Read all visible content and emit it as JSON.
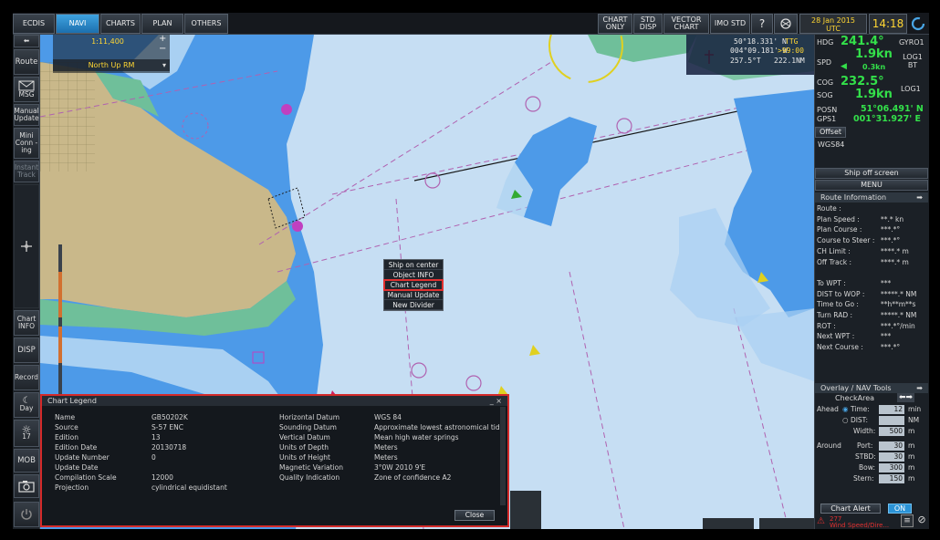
{
  "topbar": {
    "tabs": [
      "ECDIS",
      "NAVI",
      "CHARTS",
      "PLAN",
      "OTHERS"
    ],
    "chart_only": "CHART ONLY",
    "std_disp": "STD DISP",
    "vector_chart": "VECTOR CHART",
    "imo_std": "IMO STD",
    "date": "28 Jan 2015",
    "tz": "UTC",
    "time": "14:18"
  },
  "leftbar": {
    "route": "Route",
    "msg": "MSG",
    "manual_update": "Manual Update",
    "mini_conning": "Mini Conn -ing",
    "instant_track": "Instant Track",
    "chart_info": "Chart INFO",
    "disp": "DISP",
    "record": "Record",
    "day": "Day",
    "brightness": "17",
    "mob": "MOB"
  },
  "map": {
    "scale": "1:11,400",
    "orientation": "North Up RM",
    "cursor": {
      "lat": "50°18.331' N",
      "lon": "004°09.181' W",
      "brg": "257.5°T",
      "rng": "222.1NM",
      "ttg": "TTG",
      "ttg_val": ">99:00"
    }
  },
  "context_menu": {
    "items": [
      "Ship on center",
      "Object INFO",
      "Chart Legend",
      "Manual Update",
      "New Divider"
    ]
  },
  "legend": {
    "title": "Chart Legend",
    "left": [
      [
        "Name",
        "GB50202K"
      ],
      [
        "Source",
        "S-57 ENC"
      ],
      [
        "Edition",
        "13"
      ],
      [
        "Edition Date",
        "20130718"
      ],
      [
        "Update Number",
        "0"
      ],
      [
        "Update Date",
        ""
      ],
      [
        "Compilation Scale",
        "12000"
      ],
      [
        "Projection",
        "cylindrical equidistant"
      ]
    ],
    "right": [
      [
        "Horizontal Datum",
        "WGS 84"
      ],
      [
        "Sounding Datum",
        "Approximate lowest astronomical tide"
      ],
      [
        "Vertical Datum",
        "Mean high water springs"
      ],
      [
        "Units of Depth",
        "Meters"
      ],
      [
        "Units of Height",
        "Meters"
      ],
      [
        "Magnetic Variation",
        "3°0W 2010 9'E"
      ],
      [
        "Quality Indication",
        "Zone of confidence A2"
      ]
    ],
    "close": "Close"
  },
  "right": {
    "hdg_label": "HDG",
    "hdg": "241.4°",
    "hdg_src": "GYRO1",
    "spd_label": "SPD",
    "spd": "1.9kn",
    "spd_src": "LOG1 BT",
    "spd_sub": "0.3kn",
    "cog_label": "COG",
    "cog": "232.5°",
    "sog_label": "SOG",
    "sog": "1.9kn",
    "sog_src": "LOG1",
    "posn_label": "POSN",
    "gps_label": "GPS1",
    "lat": "51°06.491' N",
    "lon": "001°31.927' E",
    "offset": "Offset",
    "datum": "WGS84",
    "ship_off": "Ship off screen",
    "menu": "MENU",
    "route_info": "Route Information",
    "route_rows": [
      [
        "Route :",
        ""
      ],
      [
        "Plan Speed :",
        "**.* kn"
      ],
      [
        "Plan Course :",
        "***.*°"
      ],
      [
        "Course to Steer :",
        "***.*°"
      ],
      [
        "CH Limit :",
        "****.* m"
      ],
      [
        "Off Track :",
        "****.* m"
      ],
      [
        "",
        ""
      ],
      [
        "To WPT :",
        "***"
      ],
      [
        "DIST to WOP :",
        "*****.* NM"
      ],
      [
        "Time to Go :",
        "**h**m**s"
      ],
      [
        "Turn RAD :",
        "*****.* NM"
      ],
      [
        "ROT :",
        "***.*°/min"
      ],
      [
        "Next WPT :",
        "***"
      ],
      [
        "Next Course :",
        "***.*°"
      ]
    ],
    "overlay_tools": "Overlay / NAV Tools",
    "check_area": "CheckArea",
    "ahead": "Ahead",
    "time_lbl": "Time:",
    "time_val": "12",
    "time_unit": "min",
    "dist_lbl": "DIST:",
    "dist_unit": "NM",
    "width_lbl": "Width:",
    "width_val": "500",
    "width_unit": "m",
    "around": "Around",
    "port_lbl": "Port:",
    "port_val": "30",
    "stbd_lbl": "STBD:",
    "stbd_val": "30",
    "bow_lbl": "Bow:",
    "bow_val": "300",
    "stern_lbl": "Stern:",
    "stern_val": "150",
    "unit_m": "m",
    "chart_alert": "Chart Alert",
    "on": "ON",
    "alert_num": "277",
    "alert_text": "Wind Speed/Dire..."
  },
  "colors": {
    "accent": "#2b93d6",
    "heading_green": "#33e04a",
    "time_yellow": "#ffd633",
    "alert_red": "#e03030"
  }
}
